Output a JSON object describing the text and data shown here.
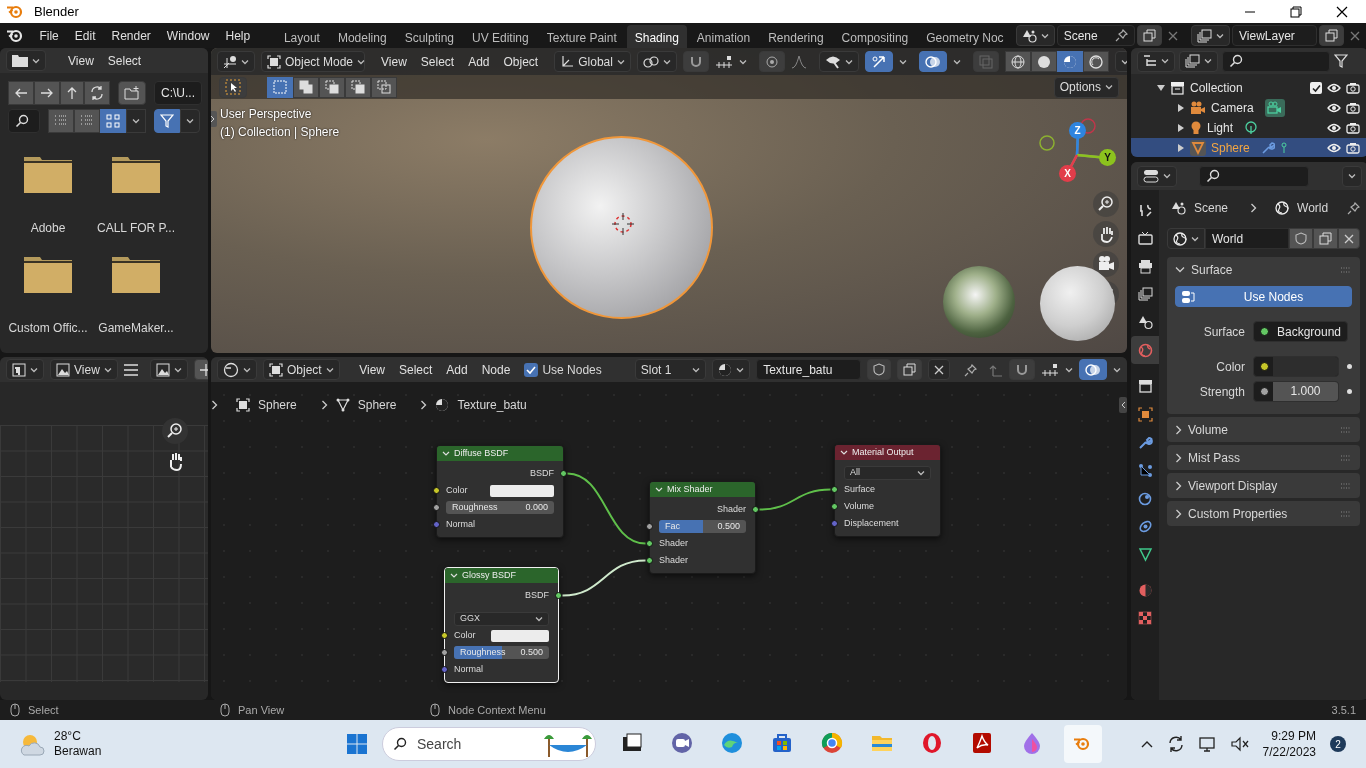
{
  "window": {
    "title": "Blender"
  },
  "menu": [
    "File",
    "Edit",
    "Render",
    "Window",
    "Help"
  ],
  "workspaces": [
    {
      "label": "Layout",
      "selected": false
    },
    {
      "label": "Modeling",
      "selected": false
    },
    {
      "label": "Sculpting",
      "selected": false
    },
    {
      "label": "UV Editing",
      "selected": false
    },
    {
      "label": "Texture Paint",
      "selected": false
    },
    {
      "label": "Shading",
      "selected": true
    },
    {
      "label": "Animation",
      "selected": false
    },
    {
      "label": "Rendering",
      "selected": false
    },
    {
      "label": "Compositing",
      "selected": false
    },
    {
      "label": "Geometry Noc",
      "selected": false
    }
  ],
  "scene": "Scene",
  "view_layer": "ViewLayer",
  "file_browser": {
    "menu": [
      "View",
      "Select"
    ],
    "path": "C:\\U...",
    "display_modes": [
      {
        "selected": false
      },
      {
        "selected": false
      },
      {
        "selected": true
      }
    ],
    "filter_on": true,
    "folders": [
      "Adobe",
      "CALL FOR P...",
      "Custom Offic...",
      "GameMaker..."
    ]
  },
  "image_editor": {
    "view": "View"
  },
  "viewport": {
    "mode": "Object Mode",
    "menu": [
      "View",
      "Select",
      "Add",
      "Object"
    ],
    "orientation": "Global",
    "options": "Options",
    "info": [
      "User Perspective",
      "(1) Collection | Sphere"
    ],
    "shading": [
      {
        "selected": false
      },
      {
        "selected": false
      },
      {
        "selected": true
      },
      {
        "selected": false
      }
    ],
    "gizmo": [
      "Z",
      "Y",
      "X"
    ]
  },
  "outliner": {
    "items": [
      {
        "label": "Collection",
        "kind": "collection",
        "checked": true,
        "expanded": true,
        "selected": false,
        "children": [
          {
            "label": "Camera",
            "kind": "camera",
            "expanded": false,
            "selected": false
          },
          {
            "label": "Light",
            "kind": "light",
            "expanded": false,
            "selected": false
          },
          {
            "label": "Sphere",
            "kind": "mesh",
            "expanded": false,
            "selected": true
          }
        ]
      }
    ]
  },
  "node_editor": {
    "mode": "Object",
    "menu": [
      "View",
      "Select",
      "Add",
      "Node"
    ],
    "use_nodes": {
      "label": "Use Nodes",
      "checked": true
    },
    "slot": "Slot 1",
    "material": "Texture_batu",
    "breadcrumb": [
      "Sphere",
      "Sphere",
      "Texture_batu"
    ],
    "nodes": [
      {
        "title": "Diffuse BSDF",
        "kind": "shader",
        "selected": false,
        "outputs": [
          {
            "label": "BSDF",
            "color": "#63c763"
          }
        ],
        "inputs": [
          {
            "label": "Color",
            "kind": "color",
            "color": "#c7c729"
          },
          {
            "label": "Roughness",
            "kind": "value",
            "color": "#a1a1a1",
            "value": "0.000",
            "level": 0
          },
          {
            "label": "Normal",
            "kind": "socket",
            "color": "#6363c7"
          }
        ]
      },
      {
        "title": "Glossy BSDF",
        "kind": "shader",
        "selected": true,
        "outputs": [
          {
            "label": "BSDF",
            "color": "#63c763"
          }
        ],
        "option": "GGX",
        "inputs": [
          {
            "label": "Color",
            "kind": "color",
            "color": "#c7c729"
          },
          {
            "label": "Roughness",
            "kind": "value",
            "color": "#a1a1a1",
            "value": "0.500",
            "level": 0.5
          },
          {
            "label": "Normal",
            "kind": "socket",
            "color": "#6363c7"
          }
        ]
      },
      {
        "title": "Mix Shader",
        "kind": "shader",
        "selected": false,
        "outputs": [
          {
            "label": "Shader",
            "color": "#63c763"
          }
        ],
        "inputs": [
          {
            "label": "Fac",
            "kind": "value",
            "color": "#a1a1a1",
            "value": "0.500",
            "level": 0.5
          },
          {
            "label": "Shader",
            "kind": "socket",
            "color": "#63c763"
          },
          {
            "label": "Shader",
            "kind": "socket",
            "color": "#63c763"
          }
        ]
      },
      {
        "title": "Material Output",
        "kind": "output",
        "selected": false,
        "option": "All",
        "inputs": [
          {
            "label": "Surface",
            "kind": "socket",
            "color": "#63c763"
          },
          {
            "label": "Volume",
            "kind": "socket",
            "color": "#63c763"
          },
          {
            "label": "Displacement",
            "kind": "socket",
            "color": "#6363c7"
          }
        ]
      }
    ]
  },
  "properties": {
    "tabs": [
      {
        "kind": "tool",
        "selected": false
      },
      {
        "kind": "render",
        "selected": false
      },
      {
        "kind": "output",
        "selected": false
      },
      {
        "kind": "view_layer",
        "selected": false
      },
      {
        "kind": "scene",
        "selected": false
      },
      {
        "kind": "world",
        "selected": true
      },
      {
        "kind": "collection",
        "selected": false
      },
      {
        "kind": "object",
        "selected": false
      },
      {
        "kind": "modifiers",
        "selected": false
      },
      {
        "kind": "particles",
        "selected": false
      },
      {
        "kind": "physics",
        "selected": false
      },
      {
        "kind": "constraints",
        "selected": false
      },
      {
        "kind": "data",
        "selected": false
      },
      {
        "kind": "material",
        "selected": false
      },
      {
        "kind": "texture",
        "selected": false
      }
    ],
    "breadcrumb": [
      "Scene",
      "World"
    ],
    "world": "World",
    "panels": [
      {
        "title": "Surface",
        "expanded": true,
        "use_nodes": "Use Nodes",
        "fields": [
          {
            "label": "Surface",
            "kind": "link",
            "color": "#63c763",
            "value": "Background"
          },
          {
            "label": "Color",
            "kind": "color",
            "color": "#c7c729"
          },
          {
            "label": "Strength",
            "kind": "value",
            "color": "#a1a1a1",
            "value": "1.000"
          }
        ]
      },
      {
        "title": "Volume",
        "expanded": false
      },
      {
        "title": "Mist Pass",
        "expanded": false
      },
      {
        "title": "Viewport Display",
        "expanded": false
      },
      {
        "title": "Custom Properties",
        "expanded": false
      }
    ]
  },
  "status_bar": {
    "hints": [
      "Select",
      "Pan View",
      "Node Context Menu"
    ],
    "version": "3.5.1"
  },
  "taskbar": {
    "temperature": "28°C",
    "weather": "Berawan",
    "search": {
      "placeholder": "Search"
    },
    "time": "9:29 PM",
    "date": "7/22/2023",
    "notifications": "2"
  }
}
